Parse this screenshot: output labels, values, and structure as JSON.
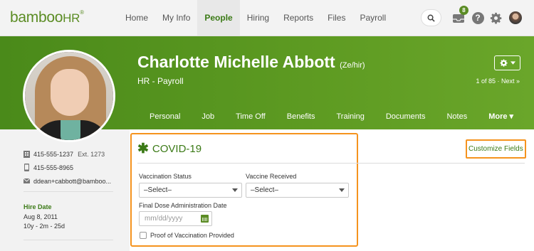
{
  "app": {
    "logo_text": "bamboo",
    "logo_hr": "HR",
    "logo_mark": "®",
    "brand_color": "#5b8c24",
    "highlight_color": "#f5931e"
  },
  "nav": {
    "items": [
      "Home",
      "My Info",
      "People",
      "Hiring",
      "Reports",
      "Files",
      "Payroll"
    ],
    "active": "People",
    "inbox_count": "8",
    "help_label": "?"
  },
  "employee": {
    "name": "Charlotte Michelle Abbott",
    "pronouns": "(Ze/hir)",
    "department": "HR - Payroll",
    "pager": "1 of 85 · Next »"
  },
  "tabs": [
    "Personal",
    "Job",
    "Time Off",
    "Benefits",
    "Training",
    "Documents",
    "Notes",
    "More ▾"
  ],
  "contact": {
    "work_phone": "415-555-1237",
    "extension": "Ext. 1273",
    "mobile_phone": "415-555-8965",
    "email": "ddean+cabbott@bamboo..."
  },
  "hire": {
    "title": "Hire Date",
    "date": "Aug 8, 2011",
    "tenure": "10y - 2m - 25d"
  },
  "covid": {
    "title": "COVID-19",
    "customize_label": "Customize Fields",
    "vaccination_status_label": "Vaccination Status",
    "vaccination_status_value": "–Select–",
    "vaccine_received_label": "Vaccine Received",
    "vaccine_received_value": "–Select–",
    "final_dose_label": "Final Dose Administration Date",
    "final_dose_placeholder": "mm/dd/yyyy",
    "proof_label": "Proof of Vaccination Provided"
  }
}
